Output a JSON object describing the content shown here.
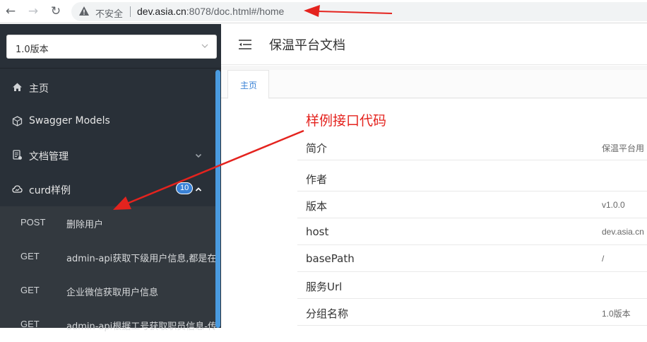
{
  "browser": {
    "insecure_label": "不安全",
    "url_host": "dev.asia.cn",
    "url_rest": ":8078/doc.html#/home"
  },
  "sidebar": {
    "version_select": {
      "value": "1.0版本"
    },
    "menu": [
      {
        "label": "主页",
        "icon": "home-icon"
      },
      {
        "label": "Swagger Models",
        "icon": "cube-icon"
      },
      {
        "label": "文档管理",
        "icon": "document-icon",
        "arrow": "chevron-down-icon"
      },
      {
        "label": "curd样例",
        "icon": "cloud-icon",
        "badge": "10",
        "arrow": "chevron-up-icon"
      }
    ],
    "sub_items": [
      {
        "method": "POST",
        "summary": "删除用户"
      },
      {
        "method": "GET",
        "summary": "admin-api获取下级用户信息,都是在"
      },
      {
        "method": "GET",
        "summary": "企业微信获取用户信息"
      },
      {
        "method": "GET",
        "summary": "admin-api根据工号获取职员信息-传"
      }
    ]
  },
  "header": {
    "title": "保温平台文档"
  },
  "tabs": [
    {
      "label": "主页"
    }
  ],
  "info_rows": [
    {
      "key": "简介",
      "value": "保温平台用"
    },
    {
      "key": "作者",
      "value": ""
    },
    {
      "key": "版本",
      "value": "v1.0.0"
    },
    {
      "key": "host",
      "value": "dev.asia.cn"
    },
    {
      "key": "basePath",
      "value": "/"
    },
    {
      "key": "服务Url",
      "value": ""
    },
    {
      "key": "分组名称",
      "value": "1.0版本"
    }
  ],
  "annotation": {
    "text": "样例接口代码",
    "color": "#e4231e"
  },
  "colors": {
    "sidebar_bg": "#293038",
    "accent": "#3a82d6",
    "scrollbar": "#4a9be0"
  }
}
